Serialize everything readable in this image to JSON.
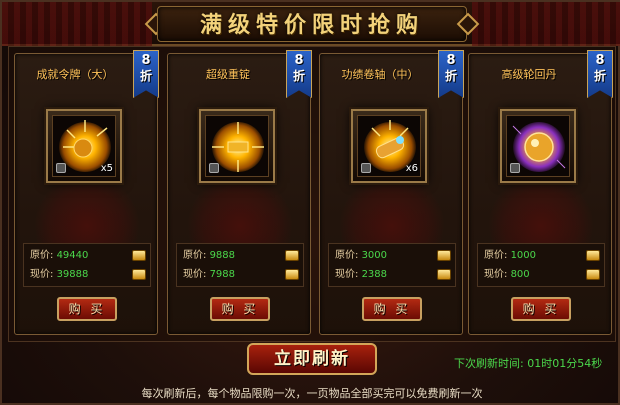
{
  "header": {
    "title": "满级特价限时抢购"
  },
  "labels": {
    "original": "原价:",
    "current": "现价:",
    "buy": "购 买"
  },
  "items": [
    {
      "name": "成就令牌（大）",
      "discount_num": "8",
      "discount_unit": "折",
      "qty": "x5",
      "original_price": "49440",
      "current_price": "39888",
      "icon": "gold-token-icon"
    },
    {
      "name": "超级重锭",
      "discount_num": "8",
      "discount_unit": "折",
      "qty": "",
      "original_price": "9888",
      "current_price": "7988",
      "icon": "gold-ingot-icon"
    },
    {
      "name": "功绩卷轴（中）",
      "discount_num": "8",
      "discount_unit": "折",
      "qty": "x6",
      "original_price": "3000",
      "current_price": "2388",
      "icon": "scroll-icon"
    },
    {
      "name": "高级轮回丹",
      "discount_num": "8",
      "discount_unit": "折",
      "qty": "",
      "original_price": "1000",
      "current_price": "800",
      "icon": "elixir-pill-icon"
    }
  ],
  "footer": {
    "refresh_label": "立即刷新",
    "timer_label": "下次刷新时间:",
    "timer_value": "01时01分54秒",
    "note": "每次刷新后，每个物品限购一次，一页物品全部买完可以免费刷新一次"
  },
  "colors": {
    "accent": "#f3d27a",
    "price_green": "#4bd84b",
    "badge_blue": "#2b63c8"
  }
}
